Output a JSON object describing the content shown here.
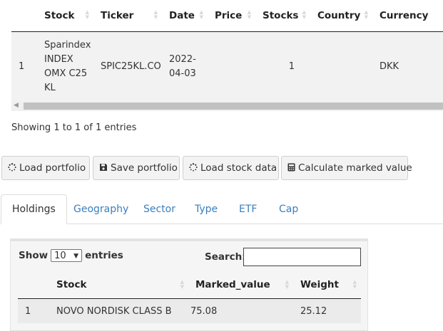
{
  "top_table": {
    "columns": [
      "",
      "Stock",
      "Ticker",
      "Date",
      "Price",
      "Stocks",
      "Country",
      "Currency"
    ],
    "row": {
      "index": "1",
      "stock_lines": [
        "Sparindex",
        "INDEX",
        "OMX C25",
        "KL"
      ],
      "ticker": "SPIC25KL.CO",
      "date_lines": [
        "2022-",
        "04-03"
      ],
      "price": "",
      "stocks": "1",
      "country": "",
      "currency": "DKK"
    },
    "info": "Showing 1 to 1 of 1 entries"
  },
  "buttons": {
    "load_portfolio": "Load portfolio",
    "save_portfolio": "Save portfolio",
    "load_stock_data": "Load stock data",
    "calculate": "Calculate marked value"
  },
  "tabs": [
    "Holdings",
    "Geography",
    "Sector",
    "Type",
    "ETF",
    "Cap"
  ],
  "holdings": {
    "show_label": "Show",
    "entries_label": "entries",
    "page_size": "10",
    "search_label": "Search:",
    "search_value": "",
    "columns": [
      "",
      "Stock",
      "Marked_value",
      "Weight"
    ],
    "rows": [
      {
        "index": "1",
        "stock": "NOVO NORDISK CLASS B",
        "marked_value": "75.08",
        "weight": "25.12"
      }
    ]
  },
  "icons": {
    "spinner": "spinner-icon",
    "save": "floppy-disk-icon",
    "calculator": "calculator-icon",
    "sort": "sort-icon"
  }
}
